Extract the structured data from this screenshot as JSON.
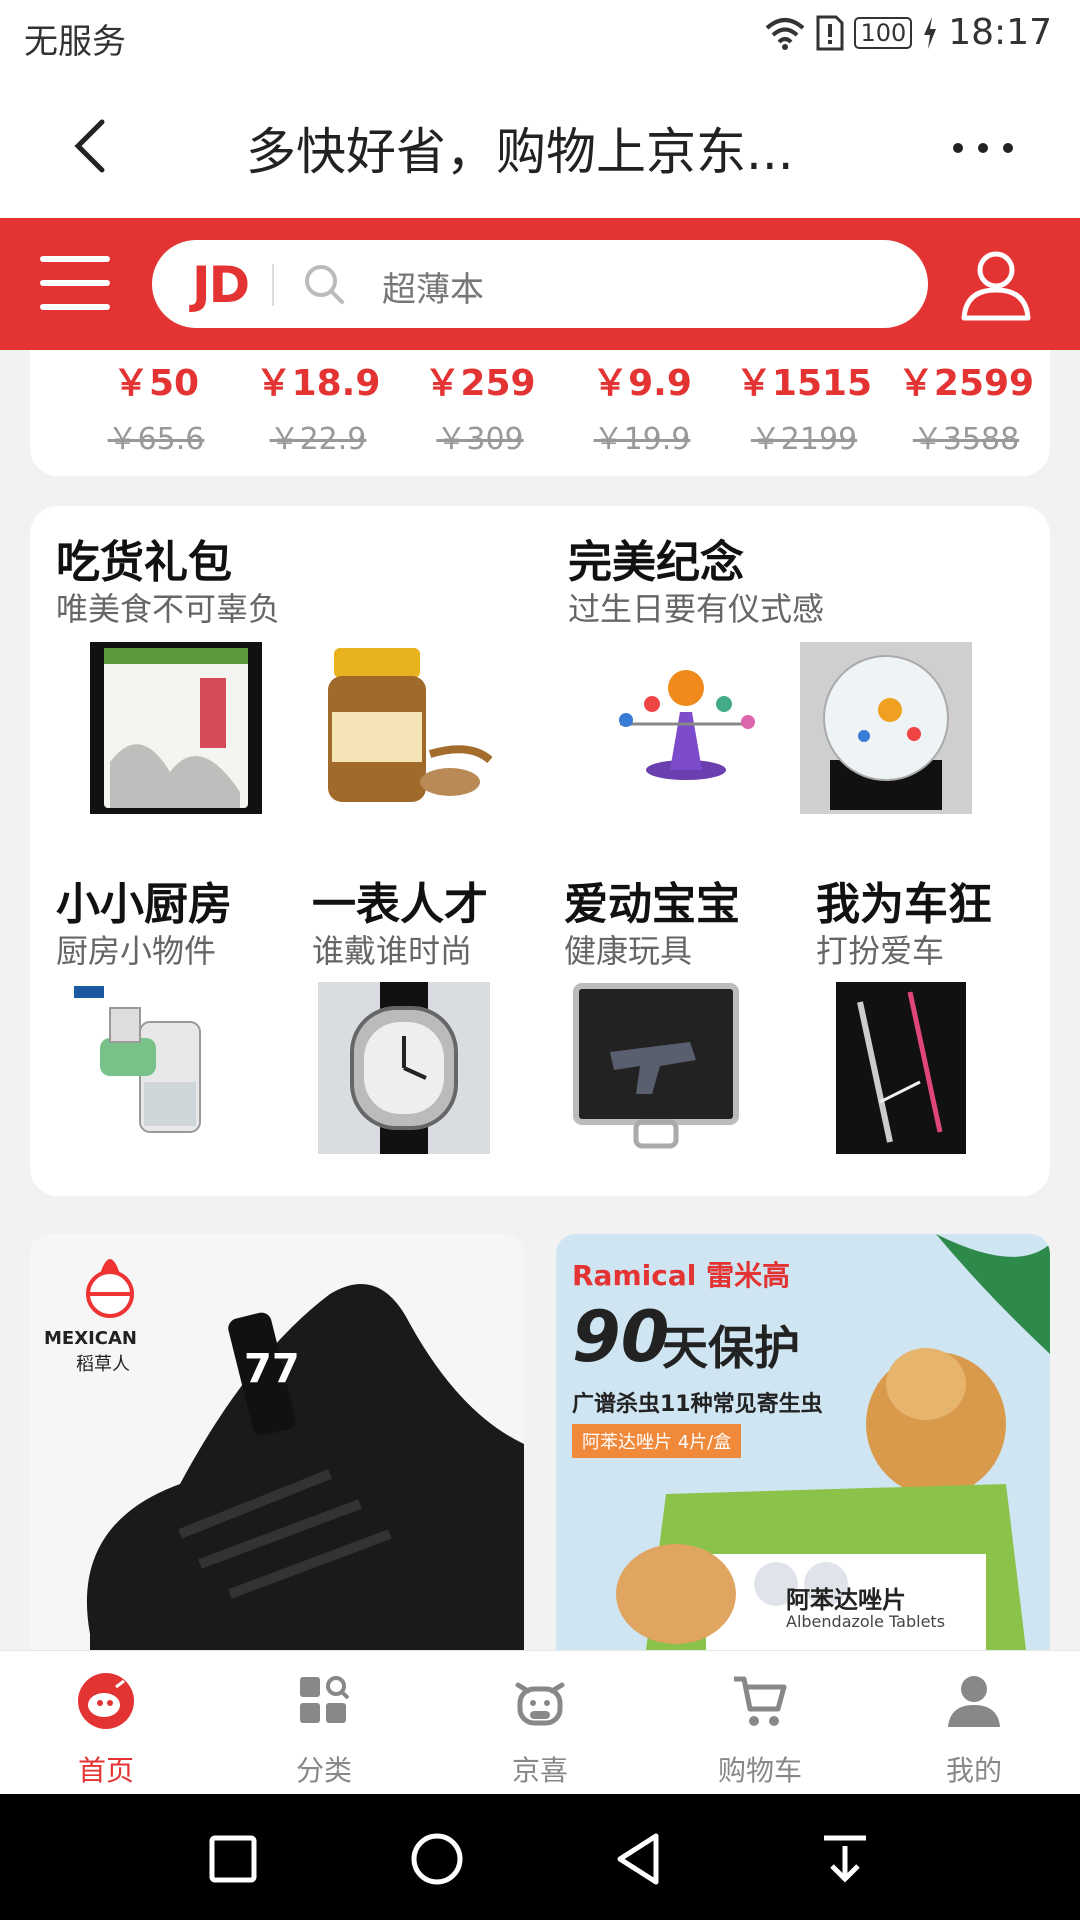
{
  "status_bar": {
    "carrier": "无服务",
    "battery": "100",
    "time": "18:17"
  },
  "title_bar": {
    "title": "多快好省，购物上京东..."
  },
  "search": {
    "logo": "JD",
    "placeholder": "超薄本"
  },
  "prices": [
    {
      "now": "￥50",
      "old": "￥65.6"
    },
    {
      "now": "￥18.9",
      "old": "￥22.9"
    },
    {
      "now": "￥259",
      "old": "￥309"
    },
    {
      "now": "￥9.9",
      "old": "￥19.9"
    },
    {
      "now": "￥1515",
      "old": "￥2199"
    },
    {
      "now": "￥2599",
      "old": "￥3588"
    }
  ],
  "categories": {
    "row1": [
      {
        "title": "吃货礼包",
        "subtitle": "唯美食不可辜负"
      },
      {
        "title": "完美纪念",
        "subtitle": "过生日要有仪式感"
      }
    ],
    "row2": [
      {
        "title": "小小厨房",
        "subtitle": "厨房小物件"
      },
      {
        "title": "一表人才",
        "subtitle": "谁戴谁时尚"
      },
      {
        "title": "爱动宝宝",
        "subtitle": "健康玩具"
      },
      {
        "title": "我为车狂",
        "subtitle": "打扮爱车"
      }
    ]
  },
  "ads": {
    "left": {
      "brand_en": "MEXICAN",
      "brand_cn": "稻草人",
      "shoe_number": "77"
    },
    "right": {
      "brand": "Ramical 雷米高",
      "headline_num": "90",
      "headline_text": "天保护",
      "subline": "广谱杀虫11种常见寄生虫",
      "tag": "阿苯达唑片 4片/盒",
      "product_name": "阿苯达唑片",
      "product_en": "Albendazole Tablets"
    }
  },
  "bottom_nav": [
    {
      "label": "首页",
      "icon": "home-icon",
      "active": true
    },
    {
      "label": "分类",
      "icon": "category-icon",
      "active": false
    },
    {
      "label": "京喜",
      "icon": "jingxi-icon",
      "active": false
    },
    {
      "label": "购物车",
      "icon": "cart-icon",
      "active": false
    },
    {
      "label": "我的",
      "icon": "profile-icon",
      "active": false
    }
  ],
  "colors": {
    "brand_red": "#e33333",
    "price_red": "#e33333",
    "background": "#f2f2f2"
  }
}
